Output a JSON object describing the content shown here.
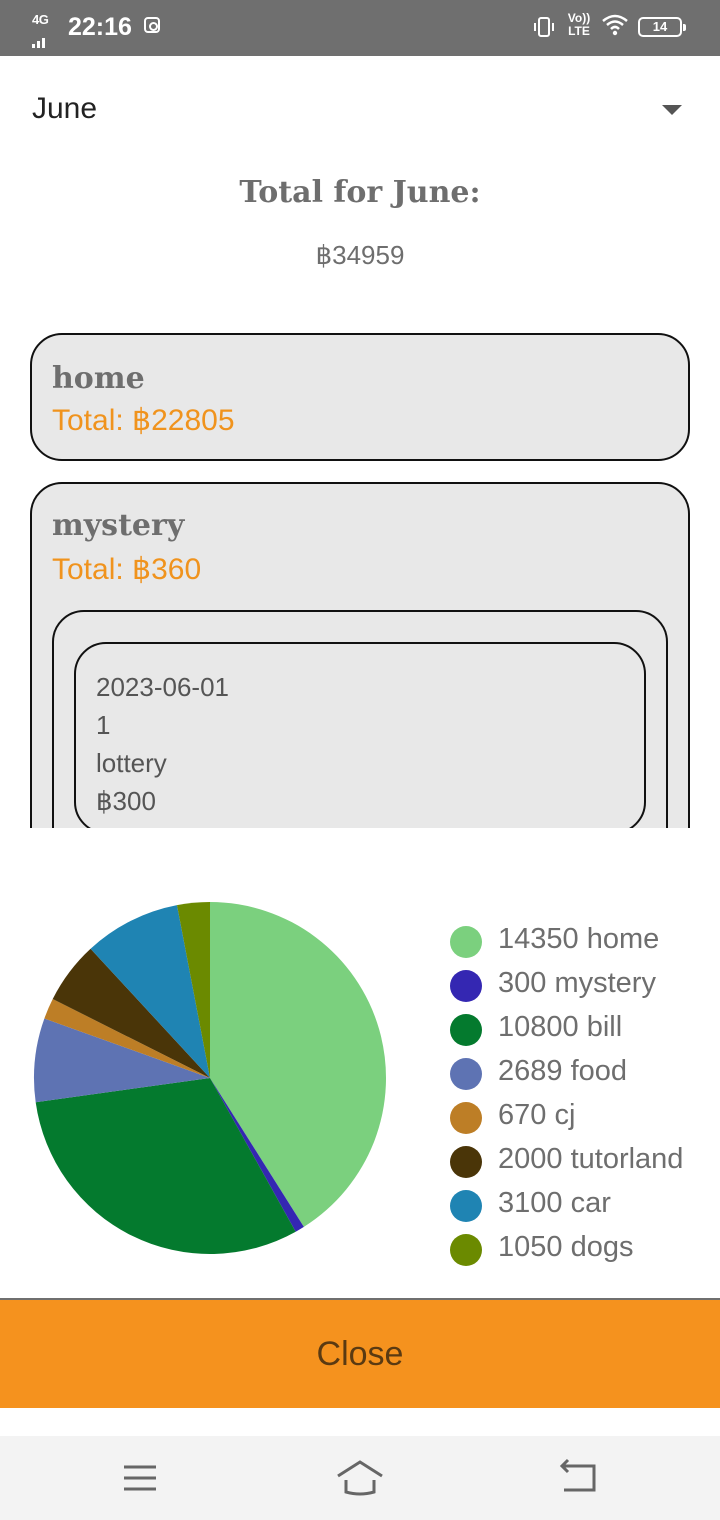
{
  "status_bar": {
    "network": "4G",
    "time": "22:16",
    "volte": "Vo)) LTE",
    "battery": "14"
  },
  "month_selector": {
    "value": "June"
  },
  "summary": {
    "title": "Total for June:",
    "amount": "฿34959"
  },
  "categories": [
    {
      "name": "home",
      "total": "Total: ฿22805"
    },
    {
      "name": "mystery",
      "total": "Total: ฿360",
      "transactions": [
        {
          "date": "2023-06-01",
          "id": "1",
          "description": "lottery",
          "amount": "฿300"
        }
      ]
    }
  ],
  "chart_data": {
    "type": "pie",
    "labels": [
      "home",
      "mystery",
      "bill",
      "food",
      "cj",
      "tutorland",
      "car",
      "dogs"
    ],
    "values": [
      14350,
      300,
      10800,
      2689,
      670,
      2000,
      3100,
      1050
    ],
    "colors": [
      "#7bd07e",
      "#3427b2",
      "#047a2e",
      "#5e73b3",
      "#bd7e26",
      "#4a3508",
      "#1f84b3",
      "#6b8a00"
    ],
    "legend": [
      "14350 home",
      "300 mystery",
      "10800 bill",
      "2689 food",
      "670 cj",
      "2000 tutorland",
      "3100 car",
      "1050 dogs"
    ],
    "legend_position": "right"
  },
  "close_button": {
    "label": "Close"
  },
  "nav_bar": {
    "icons": [
      "menu-icon",
      "home-icon",
      "back-icon"
    ]
  }
}
